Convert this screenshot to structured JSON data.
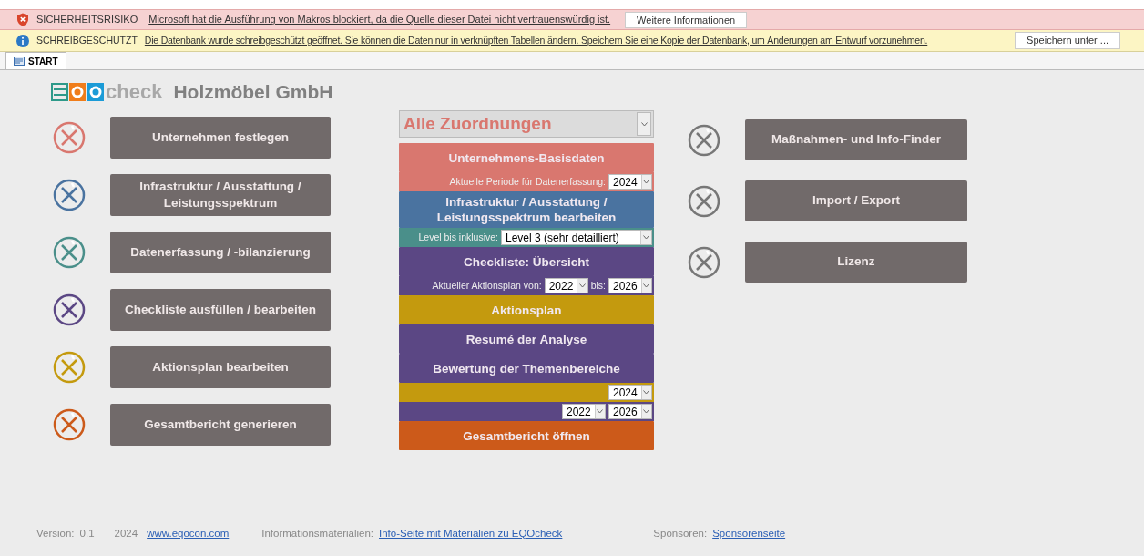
{
  "security_bar": {
    "title": "SICHERHEITSRISIKO",
    "message": "Microsoft hat die Ausführung von Makros blockiert, da die Quelle dieser Datei nicht vertrauenswürdig ist.",
    "button": "Weitere Informationen"
  },
  "readonly_bar": {
    "title": "SCHREIBGESCHÜTZT",
    "message": "Die Datenbank wurde schreibgeschützt geöffnet. Sie können die Daten nur in verknüpften Tabellen ändern. Speichern Sie eine Kopie der Datenbank, um Änderungen am Entwurf vorzunehmen.",
    "button": "Speichern unter ..."
  },
  "tabs": [
    {
      "label": "START",
      "selected": true
    }
  ],
  "header": {
    "logo_word": "check",
    "company": "Holzmöbel GmbH"
  },
  "left_steps": [
    {
      "label": "Unternehmen festlegen",
      "color": "#d9776f"
    },
    {
      "label": "Infrastruktur / Ausstattung / Leistungsspektrum",
      "color": "#4a73a0"
    },
    {
      "label": "Datenerfassung / -bilanzierung",
      "color": "#4a8f8a"
    },
    {
      "label": "Checkliste ausfüllen / bearbeiten",
      "color": "#5b4784"
    },
    {
      "label": "Aktionsplan bearbeiten",
      "color": "#c49a0e"
    },
    {
      "label": "Gesamtbericht generieren",
      "color": "#cc5a1a"
    }
  ],
  "filter_select": {
    "value": "Alle Zuordnungen"
  },
  "middle_items": [
    {
      "kind": "button",
      "label": "Unternehmens-Basisdaten",
      "color": "#d9776f"
    },
    {
      "kind": "band",
      "color": "#d9776f",
      "fields": [
        {
          "label": "Aktuelle Periode für Datenerfassung:",
          "value": "2024"
        }
      ]
    },
    {
      "kind": "button",
      "label": "Infrastruktur / Ausstattung / Leistungsspektrum bearbeiten",
      "color": "#4a73a0"
    },
    {
      "kind": "band",
      "color": "#4a8f8a",
      "fields": [
        {
          "label": "Level bis inklusive:",
          "value": "Level 3 (sehr detailliert)"
        }
      ]
    },
    {
      "kind": "button",
      "label": "Checkliste: Übersicht",
      "color": "#5b4784"
    },
    {
      "kind": "band",
      "color": "#5b4784",
      "fields": [
        {
          "label": "Aktueller Aktionsplan von:",
          "value": "2022"
        },
        {
          "label": "bis:",
          "value": "2026"
        }
      ]
    },
    {
      "kind": "button",
      "label": "Aktionsplan",
      "color": "#c49a0e"
    },
    {
      "kind": "button",
      "label": "Resumé der Analyse",
      "color": "#5b4784"
    },
    {
      "kind": "button",
      "label": "Bewertung der Themenbereiche",
      "color": "#5b4784"
    },
    {
      "kind": "band",
      "color": "#c49a0e",
      "fields": [
        {
          "value": "2024"
        }
      ]
    },
    {
      "kind": "band",
      "color": "#5b4784",
      "fields": [
        {
          "value": "2022"
        },
        {
          "value": "2026"
        }
      ]
    },
    {
      "kind": "button",
      "label": "Gesamtbericht öffnen",
      "color": "#cc5a1a"
    }
  ],
  "right_buttons": [
    {
      "label": "Maßnahmen- und Info-Finder"
    },
    {
      "label": "Import / Export"
    },
    {
      "label": "Lizenz"
    }
  ],
  "footer": {
    "version_label": "Version:",
    "version": "0.1",
    "year": "2024",
    "website": "www.eqocon.com",
    "info_label": "Informationsmaterialien:",
    "info_link": "Info-Seite mit Materialien zu EQOcheck",
    "sponsor_label": "Sponsoren:",
    "sponsor_link": "Sponsorenseite"
  }
}
